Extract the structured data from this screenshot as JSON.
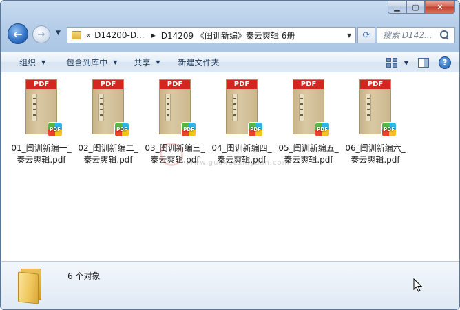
{
  "nav": {
    "address_parent": "D14200-D...",
    "address_current": "D14209 《闺训新编》秦云爽辑 6册",
    "search_placeholder": "搜索 D142..."
  },
  "toolbar": {
    "organize": "组织",
    "include_in_library": "包含到库中",
    "share": "共享",
    "new_folder": "新建文件夹"
  },
  "file_badge": "PDF",
  "files": [
    {
      "name": "01_闺训新编一_秦云爽辑.pdf"
    },
    {
      "name": "02_闺训新编二_秦云爽辑.pdf"
    },
    {
      "name": "03_闺训新编三_秦云爽辑.pdf"
    },
    {
      "name": "04_闺训新编四_秦云爽辑.pdf"
    },
    {
      "name": "05_闺训新编五_秦云爽辑.pdf"
    },
    {
      "name": "06_闺训新编六_秦云爽辑.pdf"
    }
  ],
  "watermark": {
    "url": "www.guoxuezhiyuan.com"
  },
  "status": {
    "count_text": "6 个对象"
  },
  "icons": {
    "back": "back-arrow-icon",
    "forward": "forward-arrow-icon",
    "refresh": "refresh-icon",
    "search": "search-icon",
    "view": "view-options-icon",
    "preview_pane": "preview-pane-icon",
    "help": "help-icon",
    "folder": "folder-icon",
    "pdf": "pdf-file-icon"
  },
  "colors": {
    "pdf_band": "#d3261e",
    "accent": "#2f6fc4"
  }
}
